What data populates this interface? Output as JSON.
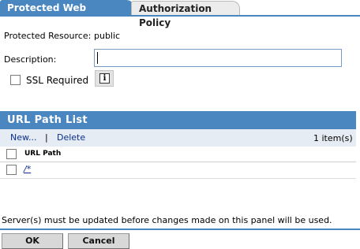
{
  "tabs": [
    {
      "label": "Protected Web Resource",
      "active": true
    },
    {
      "label": "Authorization Policy",
      "active": false
    }
  ],
  "form": {
    "protected_resource_label": "Protected Resource:",
    "protected_resource_value": "public",
    "description_label": "Description:",
    "description_value": "",
    "ssl_label": "SSL Required",
    "ssl_checked": false,
    "info_icon": "info-icon"
  },
  "url_path_list": {
    "title": "URL Path List",
    "new_label": "New...",
    "separator": "|",
    "delete_label": "Delete",
    "item_count": "1 item(s)",
    "column_header": "URL Path",
    "rows": [
      {
        "path": "/*",
        "checked": false
      }
    ]
  },
  "footer": {
    "notice": "Server(s) must be updated before changes made on this panel will be used.",
    "ok_label": "OK",
    "cancel_label": "Cancel"
  },
  "colors": {
    "accent": "#4a86bf",
    "toolbar_bg": "#e6ecf3",
    "link": "#0b2f8c"
  }
}
